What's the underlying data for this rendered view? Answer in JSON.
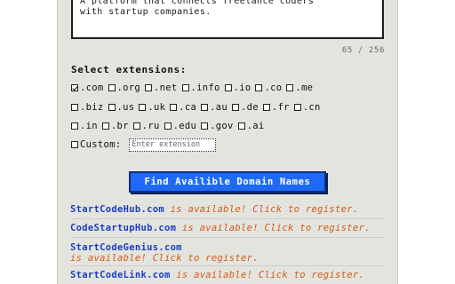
{
  "description": {
    "text": "A platform that connects freelance coders\nwith startup companies."
  },
  "char_counter": "65 / 256",
  "extensions": {
    "heading": "Select extensions:",
    "row1": [
      {
        "label": ".com",
        "checked": true
      },
      {
        "label": ".org",
        "checked": false
      },
      {
        "label": ".net",
        "checked": false
      },
      {
        "label": ".info",
        "checked": false
      },
      {
        "label": ".io",
        "checked": false
      },
      {
        "label": ".co",
        "checked": false
      },
      {
        "label": ".me",
        "checked": false
      }
    ],
    "row2": [
      {
        "label": ".biz",
        "checked": false
      },
      {
        "label": ".us",
        "checked": false
      },
      {
        "label": ".uk",
        "checked": false
      },
      {
        "label": ".ca",
        "checked": false
      },
      {
        "label": ".au",
        "checked": false
      },
      {
        "label": ".de",
        "checked": false
      },
      {
        "label": ".fr",
        "checked": false
      },
      {
        "label": ".cn",
        "checked": false
      }
    ],
    "row3": [
      {
        "label": ".in",
        "checked": false
      },
      {
        "label": ".br",
        "checked": false
      },
      {
        "label": ".ru",
        "checked": false
      },
      {
        "label": ".edu",
        "checked": false
      },
      {
        "label": ".gov",
        "checked": false
      },
      {
        "label": ".ai",
        "checked": false
      }
    ],
    "custom_label": "Custom:",
    "custom_placeholder": "Enter extension",
    "custom_value": ""
  },
  "find_button_label": "Find Availible Domain Names",
  "results": [
    {
      "domain": "StartCodeHub.com",
      "message": "is available! Click to register."
    },
    {
      "domain": "CodeStartupHub.com",
      "message": "is available! Click to register."
    },
    {
      "domain": "StartCodeGenius.com",
      "message": "is available! Click to register."
    },
    {
      "domain": "StartCodeLink.com",
      "message": "is available! Click to register."
    }
  ],
  "colors": {
    "panel_background": "#e4e4df",
    "button_background": "#1e6af7",
    "domain_link": "#1a3fbf",
    "available_text": "#d35b15"
  }
}
